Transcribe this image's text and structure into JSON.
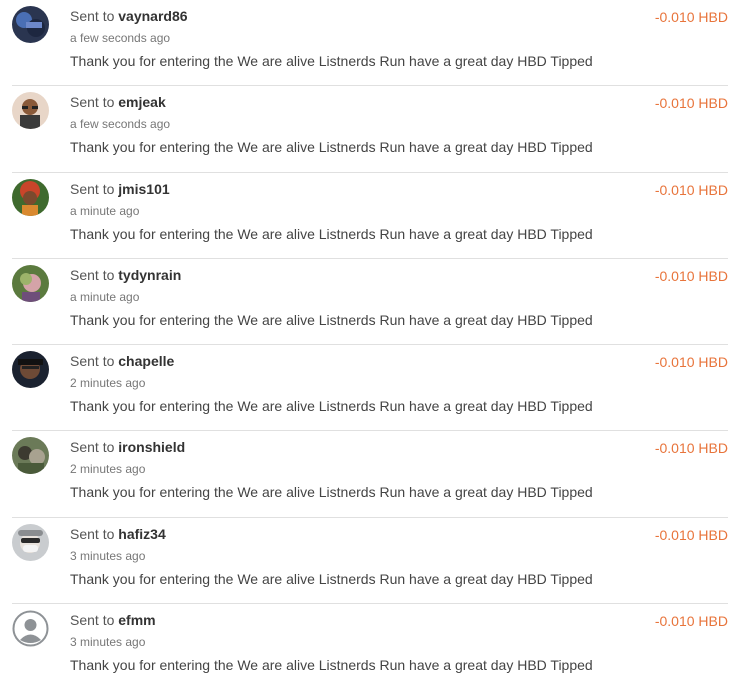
{
  "accent_amount_color": "#e8743b",
  "transfers": [
    {
      "prefix": "Sent to",
      "user": "vaynard86",
      "time": "a few seconds ago",
      "memo": "Thank you for entering the We are alive Listnerds Run have a great day HBD Tipped",
      "amount": "-0.010 HBD",
      "avatar": "avatar-photo"
    },
    {
      "prefix": "Sent to",
      "user": "emjeak",
      "time": "a few seconds ago",
      "memo": "Thank you for entering the We are alive Listnerds Run have a great day HBD Tipped",
      "amount": "-0.010 HBD",
      "avatar": "avatar-photo"
    },
    {
      "prefix": "Sent to",
      "user": "jmis101",
      "time": "a minute ago",
      "memo": "Thank you for entering the We are alive Listnerds Run have a great day HBD Tipped",
      "amount": "-0.010 HBD",
      "avatar": "avatar-photo"
    },
    {
      "prefix": "Sent to",
      "user": "tydynrain",
      "time": "a minute ago",
      "memo": "Thank you for entering the We are alive Listnerds Run have a great day HBD Tipped",
      "amount": "-0.010 HBD",
      "avatar": "avatar-photo"
    },
    {
      "prefix": "Sent to",
      "user": "chapelle",
      "time": "2 minutes ago",
      "memo": "Thank you for entering the We are alive Listnerds Run have a great day HBD Tipped",
      "amount": "-0.010 HBD",
      "avatar": "avatar-photo"
    },
    {
      "prefix": "Sent to",
      "user": "ironshield",
      "time": "2 minutes ago",
      "memo": "Thank you for entering the We are alive Listnerds Run have a great day HBD Tipped",
      "amount": "-0.010 HBD",
      "avatar": "avatar-photo"
    },
    {
      "prefix": "Sent to",
      "user": "hafiz34",
      "time": "3 minutes ago",
      "memo": "Thank you for entering the We are alive Listnerds Run have a great day HBD Tipped",
      "amount": "-0.010 HBD",
      "avatar": "avatar-photo"
    },
    {
      "prefix": "Sent to",
      "user": "efmm",
      "time": "3 minutes ago",
      "memo": "Thank you for entering the We are alive Listnerds Run have a great day HBD Tipped",
      "amount": "-0.010 HBD",
      "avatar": "default-user-icon"
    }
  ]
}
